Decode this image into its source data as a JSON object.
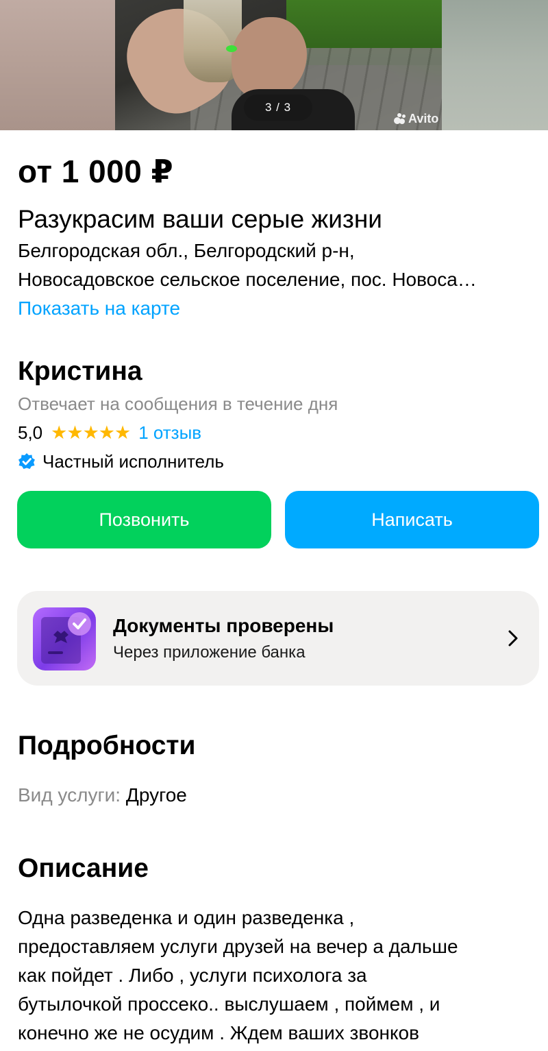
{
  "gallery": {
    "counter": "3 / 3",
    "watermark": "Avito"
  },
  "listing": {
    "price": "от 1 000 ₽",
    "title": "Разукрасим ваши серые жизни",
    "address_line1": "Белгородская обл., Белгородский р-н,",
    "address_line2": "Новосадовское сельское поселение, пос. Новоса…",
    "show_on_map": "Показать на карте"
  },
  "seller": {
    "name": "Кристина",
    "response_time": "Отвечает на сообщения в течение дня",
    "rating": "5,0",
    "stars": "★★★★★",
    "rating_value": 5,
    "reviews": "1 отзыв",
    "type": "Частный исполнитель"
  },
  "actions": {
    "call": "Позвонить",
    "write": "Написать"
  },
  "documents": {
    "title": "Документы проверены",
    "subtitle": "Через приложение банка"
  },
  "details": {
    "heading": "Подробности",
    "service_label": "Вид услуги:",
    "service_value": "Другое"
  },
  "description": {
    "heading": "Описание",
    "lines": [
      "Одна разведенка и один разведенка ,",
      "предоставляем услуги друзей на вечер а дальше",
      "как пойдет . Либо , услуги психолога за",
      "бутылочкой проссеко.. выслушаем , поймем , и",
      "конечно же не осудим . Ждем ваших звонков"
    ]
  },
  "colors": {
    "link": "#00a3ff",
    "call_button": "#02d15c",
    "write_button": "#00aaff",
    "star": "#ffb800",
    "verified_badge": "#0a9bff",
    "documents_icon": "#8a3ff0"
  }
}
